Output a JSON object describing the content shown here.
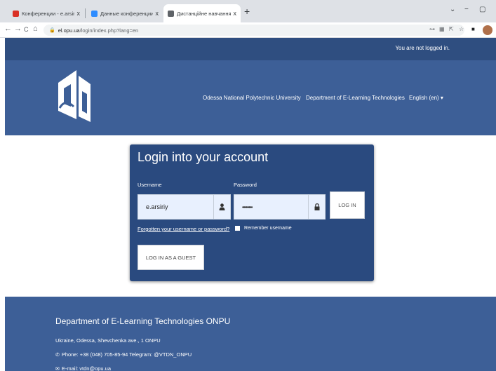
{
  "browser": {
    "tabs": [
      {
        "title": "Конференции - e.arsiriy@gmail.",
        "favicon_color": "#d93025"
      },
      {
        "title": "Данные конференции - Zoom",
        "favicon_color": "#2d8cff"
      },
      {
        "title": "Дистанційне навчання ОНПУ: Увійт",
        "favicon_color": "#5f6368"
      }
    ],
    "tab_close": "x",
    "new_tab": "+",
    "window_controls": {
      "dropdown": "⌄",
      "minimize": "−",
      "maximize": "▢"
    },
    "url_host": "el.opu.ua",
    "url_path": "/login/index.php?lang=en",
    "nav": {
      "back": "←",
      "forward": "→",
      "reload": "C",
      "home": "⌂"
    },
    "toolbar_icons": [
      "key-icon",
      "translate-icon",
      "share-icon",
      "star-icon",
      "sidebar-icon",
      "profile-avatar"
    ]
  },
  "site": {
    "login_status": "You are not logged in.",
    "header_links": {
      "university": "Odessa National Polytechnic University",
      "department": "Department of E-Learning Technologies",
      "language": "English (en) ▾"
    },
    "colors": {
      "topbar": "#2f4e80",
      "header": "#3d5f97",
      "card": "#2a4a7f"
    }
  },
  "login": {
    "title": "Login into your account",
    "username_label": "Username",
    "username_value": "e.arsiriy",
    "password_label": "Password",
    "password_value": "••••••••",
    "login_button": "LOG IN",
    "forgot_link": "Forgotten your username or password?",
    "remember_label": "Remember username",
    "guest_button": "LOG IN AS A GUEST"
  },
  "footer": {
    "title": "Department of E-Learning Technologies ONPU",
    "address": "Ukraine, Odessa, Shevchenka ave., 1 ONPU",
    "phone": "Phone: +38 (048) 705-85-94 Telegram: @VTDN_ONPU",
    "email": "E-mail: vtdn@opu.ua"
  }
}
